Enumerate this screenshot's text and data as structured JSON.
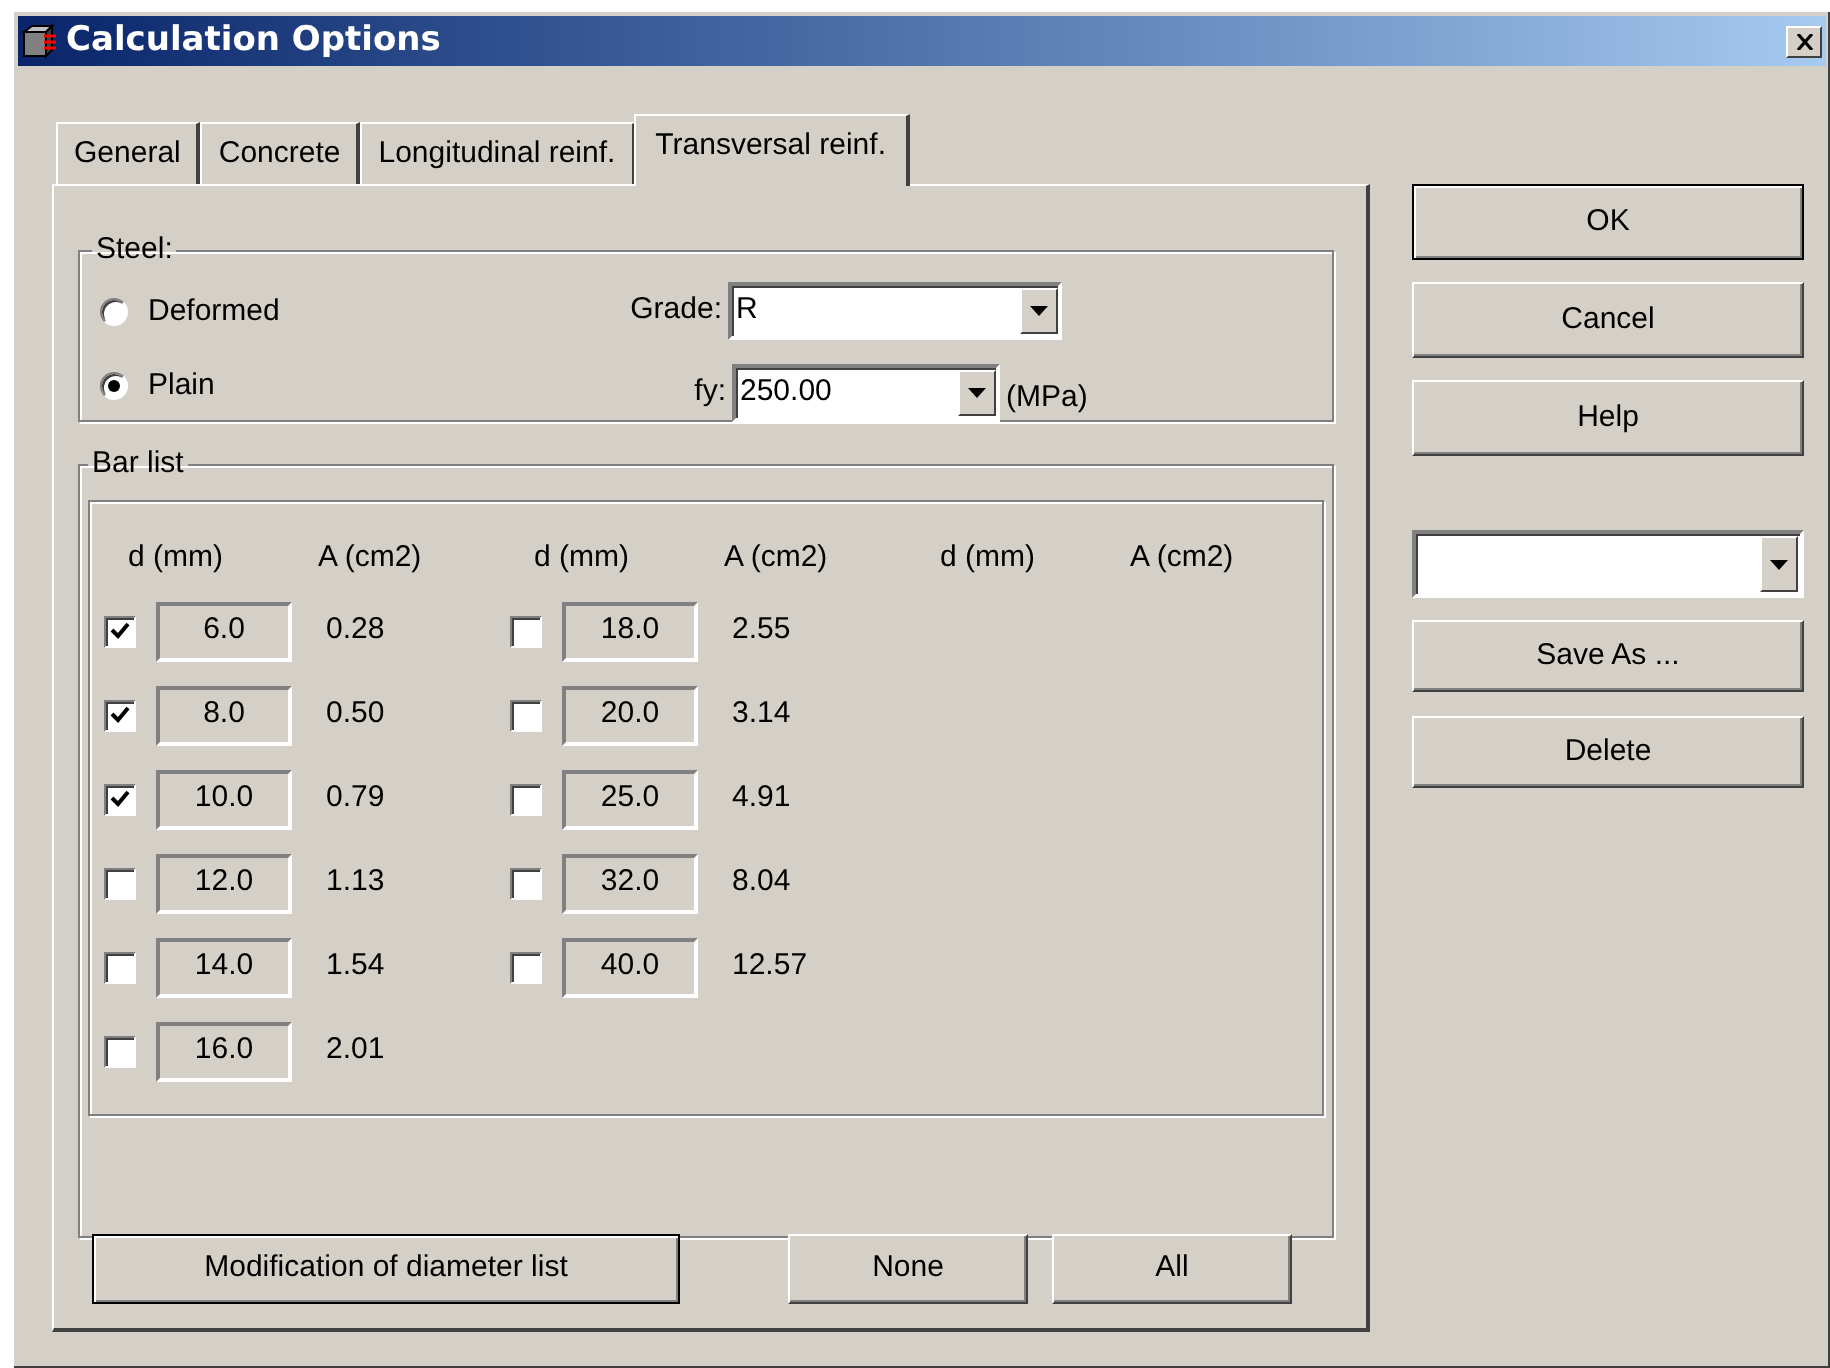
{
  "window": {
    "title": "Calculation Options"
  },
  "tabs": [
    {
      "label": "General",
      "selected": false
    },
    {
      "label": "Concrete",
      "selected": false
    },
    {
      "label": "Longitudinal reinf.",
      "selected": false
    },
    {
      "label": "Transversal reinf.",
      "selected": true
    }
  ],
  "steel": {
    "title": "Steel:",
    "options": [
      {
        "label": "Deformed",
        "selected": false
      },
      {
        "label": "Plain",
        "selected": true
      }
    ],
    "grade": {
      "label": "Grade:",
      "value": "R"
    },
    "fy": {
      "label": "fy:",
      "value": "250.00",
      "unit": "(MPa)"
    }
  },
  "bar_list": {
    "title": "Bar list",
    "columns": [
      {
        "d_heading": "d (mm)",
        "a_heading": "A (cm2)",
        "bars": [
          {
            "d": "6.0",
            "area": "0.28",
            "checked": true
          },
          {
            "d": "8.0",
            "area": "0.50",
            "checked": true
          },
          {
            "d": "10.0",
            "area": "0.79",
            "checked": true
          },
          {
            "d": "12.0",
            "area": "1.13",
            "checked": false
          },
          {
            "d": "14.0",
            "area": "1.54",
            "checked": false
          },
          {
            "d": "16.0",
            "area": "2.01",
            "checked": false
          }
        ]
      },
      {
        "d_heading": "d (mm)",
        "a_heading": "A (cm2)",
        "bars": [
          {
            "d": "18.0",
            "area": "2.55",
            "checked": false
          },
          {
            "d": "20.0",
            "area": "3.14",
            "checked": false
          },
          {
            "d": "25.0",
            "area": "4.91",
            "checked": false
          },
          {
            "d": "32.0",
            "area": "8.04",
            "checked": false
          },
          {
            "d": "40.0",
            "area": "12.57",
            "checked": false
          }
        ]
      },
      {
        "d_heading": "d (mm)",
        "a_heading": "A (cm2)"
      }
    ],
    "buttons": {
      "modify": "Modification of diameter list",
      "none": "None",
      "all": "All"
    }
  },
  "side_buttons": [
    "OK",
    "Cancel",
    "Help"
  ],
  "profile_buttons": [
    "Save As ...",
    "Delete"
  ]
}
